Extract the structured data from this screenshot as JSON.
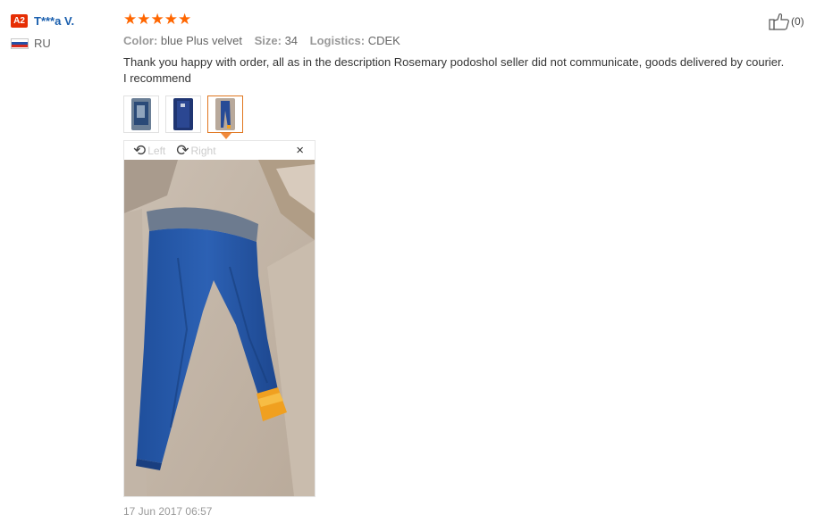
{
  "reviewer": {
    "level_badge": "A2",
    "name": "T***a V.",
    "country": "RU",
    "flag_colors": [
      "#ffffff",
      "#2451a8",
      "#d52b1e"
    ]
  },
  "review": {
    "rating": 5,
    "stars": [
      "★",
      "★",
      "★",
      "★",
      "★"
    ],
    "star_color": "#ff6600",
    "attributes": [
      {
        "key": "Color:",
        "value": "blue Plus velvet"
      },
      {
        "key": "Size:",
        "value": "34"
      },
      {
        "key": "Logistics:",
        "value": "CDEK"
      }
    ],
    "text": "Thank you happy with order, all as in the description Rosemary podoshol seller did not communicate, goods delivered by courier. I recommend",
    "date": "17 Jun 2017 06:57"
  },
  "helpful": {
    "icon": "thumbs-up-icon",
    "count": "(0)"
  },
  "viewer": {
    "rotate_left_label": "Left",
    "rotate_right_label": "Right",
    "close_label": "×",
    "rotate_left_glyph": "⟲",
    "rotate_right_glyph": "⟳",
    "selected_thumb_index": 2
  }
}
